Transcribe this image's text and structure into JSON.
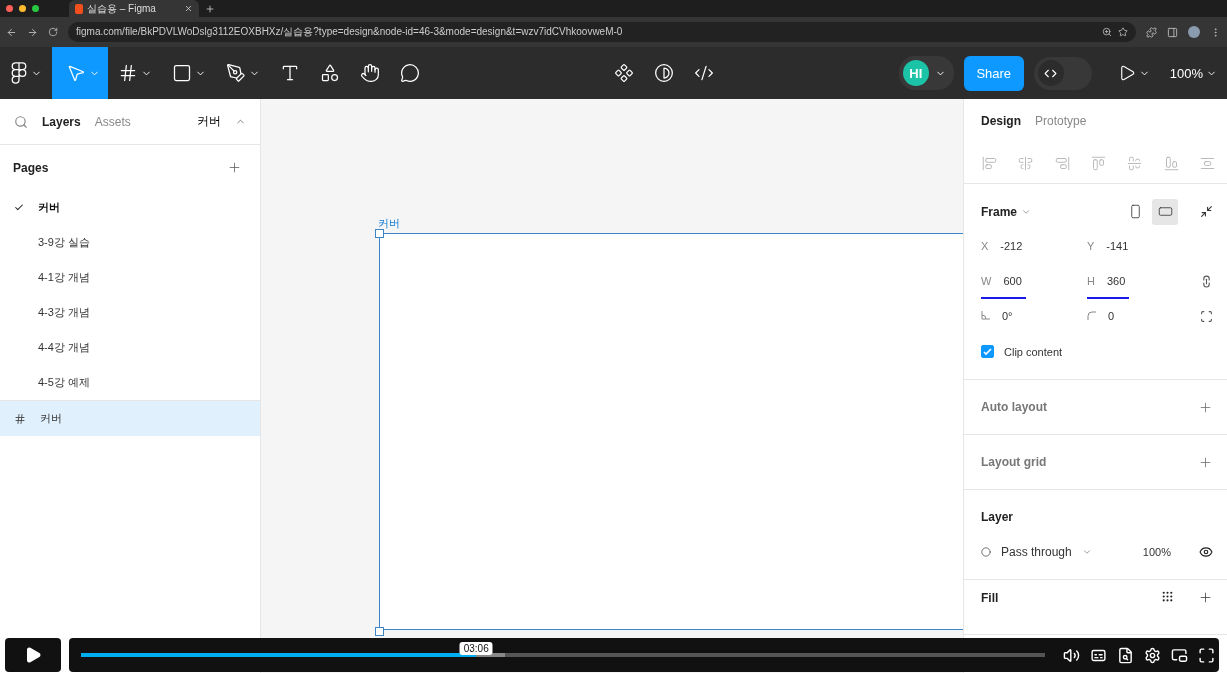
{
  "browser": {
    "tab_title": "실습용 – Figma",
    "url": "figma.com/file/BkPDVLWoDslg3112EOXBHXz/실습용?type=design&node-id=46-3&mode=design&t=wzv7idCVhkoovweM-0"
  },
  "toolbar": {
    "tools": [
      {
        "kind": "main-menu",
        "selected": false
      },
      {
        "kind": "move",
        "selected": true
      },
      {
        "kind": "frame",
        "selected": false
      },
      {
        "kind": "shape",
        "selected": false
      },
      {
        "kind": "pen",
        "selected": false
      },
      {
        "kind": "text",
        "selected": false
      },
      {
        "kind": "resources",
        "selected": false
      },
      {
        "kind": "hand",
        "selected": false
      },
      {
        "kind": "comment",
        "selected": false
      }
    ],
    "center_tools": [
      {
        "kind": "component"
      },
      {
        "kind": "mask"
      },
      {
        "kind": "dev"
      }
    ],
    "avatar": "HI",
    "share": "Share",
    "dev_mode": {
      "on": false
    },
    "zoom": "100%"
  },
  "left_panel": {
    "tabs": [
      {
        "label": "Layers",
        "selected": true
      },
      {
        "label": "Assets",
        "selected": false
      }
    ],
    "page_switcher": "커버",
    "pages_heading": "Pages",
    "pages": [
      {
        "label": "커버",
        "selected": true
      },
      {
        "label": "3-9강 실습",
        "selected": false
      },
      {
        "label": "4-1강 개념",
        "selected": false
      },
      {
        "label": "4-3강 개념",
        "selected": false
      },
      {
        "label": "4-4강 개념",
        "selected": false
      },
      {
        "label": "4-5강 예제",
        "selected": false
      }
    ],
    "layers": [
      {
        "label": "커버",
        "selected": true
      }
    ]
  },
  "canvas": {
    "frame_label": "커버"
  },
  "right_panel": {
    "tabs": [
      {
        "label": "Design",
        "selected": true
      },
      {
        "label": "Prototype",
        "selected": false
      }
    ],
    "frame": {
      "title": "Frame",
      "orientations": [
        {
          "kind": "portrait",
          "selected": false
        },
        {
          "kind": "landscape",
          "selected": true
        }
      ],
      "fields": [
        {
          "kind": "label",
          "label": "X",
          "value": "-212",
          "underlined": false
        },
        {
          "kind": "label",
          "label": "Y",
          "value": "-141",
          "underlined": false
        },
        {
          "kind": "label",
          "label": "W",
          "value": "600",
          "underlined": true
        },
        {
          "kind": "label",
          "label": "H",
          "value": "360",
          "underlined": true
        },
        {
          "kind": "rotation",
          "value": "0°",
          "underlined": false
        },
        {
          "kind": "radius",
          "value": "0",
          "underlined": false
        }
      ],
      "clip": {
        "label": "Clip content",
        "checked": true
      }
    },
    "sections": [
      {
        "title": "Auto layout"
      },
      {
        "title": "Layout grid"
      }
    ],
    "layer": {
      "title": "Layer",
      "blend": "Pass through",
      "opacity": "100%"
    },
    "fill": {
      "title": "Fill"
    }
  },
  "video": {
    "timestamp": "03:06",
    "progress": {
      "level": 0.41
    },
    "buffer": {
      "level": 0.44
    }
  }
}
